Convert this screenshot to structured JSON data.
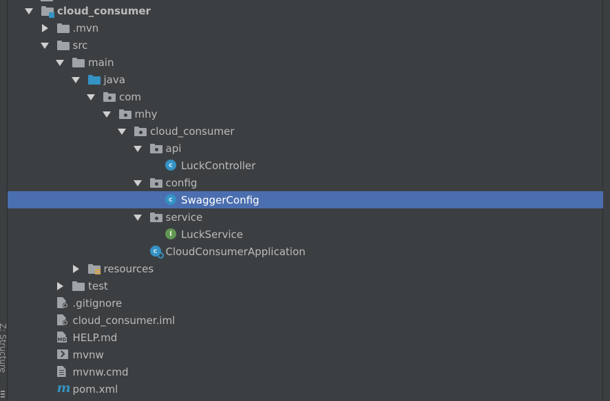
{
  "project_tree": {
    "items": [
      {
        "label": "cloud_consumer",
        "depth": 0,
        "expanded": true,
        "icon": "module-folder-icon",
        "bold": true
      },
      {
        "label": ".mvn",
        "depth": 1,
        "expanded": false,
        "icon": "folder-icon"
      },
      {
        "label": "src",
        "depth": 1,
        "expanded": true,
        "icon": "folder-icon"
      },
      {
        "label": "main",
        "depth": 2,
        "expanded": true,
        "icon": "folder-icon"
      },
      {
        "label": "java",
        "depth": 3,
        "expanded": true,
        "icon": "source-folder-icon"
      },
      {
        "label": "com",
        "depth": 4,
        "expanded": true,
        "icon": "package-icon"
      },
      {
        "label": "mhy",
        "depth": 5,
        "expanded": true,
        "icon": "package-icon"
      },
      {
        "label": "cloud_consumer",
        "depth": 6,
        "expanded": true,
        "icon": "package-icon"
      },
      {
        "label": "api",
        "depth": 7,
        "expanded": true,
        "icon": "package-icon"
      },
      {
        "label": "LuckController",
        "depth": 8,
        "icon": "class-icon"
      },
      {
        "label": "config",
        "depth": 7,
        "expanded": true,
        "icon": "package-icon"
      },
      {
        "label": "SwaggerConfig",
        "depth": 8,
        "icon": "class-icon",
        "selected": true
      },
      {
        "label": "service",
        "depth": 7,
        "expanded": true,
        "icon": "package-icon"
      },
      {
        "label": "LuckService",
        "depth": 8,
        "icon": "interface-icon"
      },
      {
        "label": "CloudConsumerApplication",
        "depth": 7,
        "icon": "spring-boot-class-icon"
      },
      {
        "label": "resources",
        "depth": 3,
        "expanded": false,
        "icon": "resources-folder-icon"
      },
      {
        "label": "test",
        "depth": 2,
        "expanded": false,
        "icon": "folder-icon"
      },
      {
        "label": ".gitignore",
        "depth": 1,
        "icon": "ignore-file-icon"
      },
      {
        "label": "cloud_consumer.iml",
        "depth": 1,
        "icon": "iml-file-icon"
      },
      {
        "label": "HELP.md",
        "depth": 1,
        "icon": "markdown-file-icon"
      },
      {
        "label": "mvnw",
        "depth": 1,
        "icon": "shell-script-icon"
      },
      {
        "label": "mvnw.cmd",
        "depth": 1,
        "icon": "text-file-icon"
      },
      {
        "label": "pom.xml",
        "depth": 1,
        "icon": "maven-pom-icon"
      }
    ]
  },
  "side_tab": {
    "label": "Z: Structure"
  },
  "colors": {
    "background": "#3c3f41",
    "selection": "#4b6eaf",
    "text": "#bbbbbb",
    "blue_icon": "#3592c4",
    "green_icon": "#629755"
  }
}
